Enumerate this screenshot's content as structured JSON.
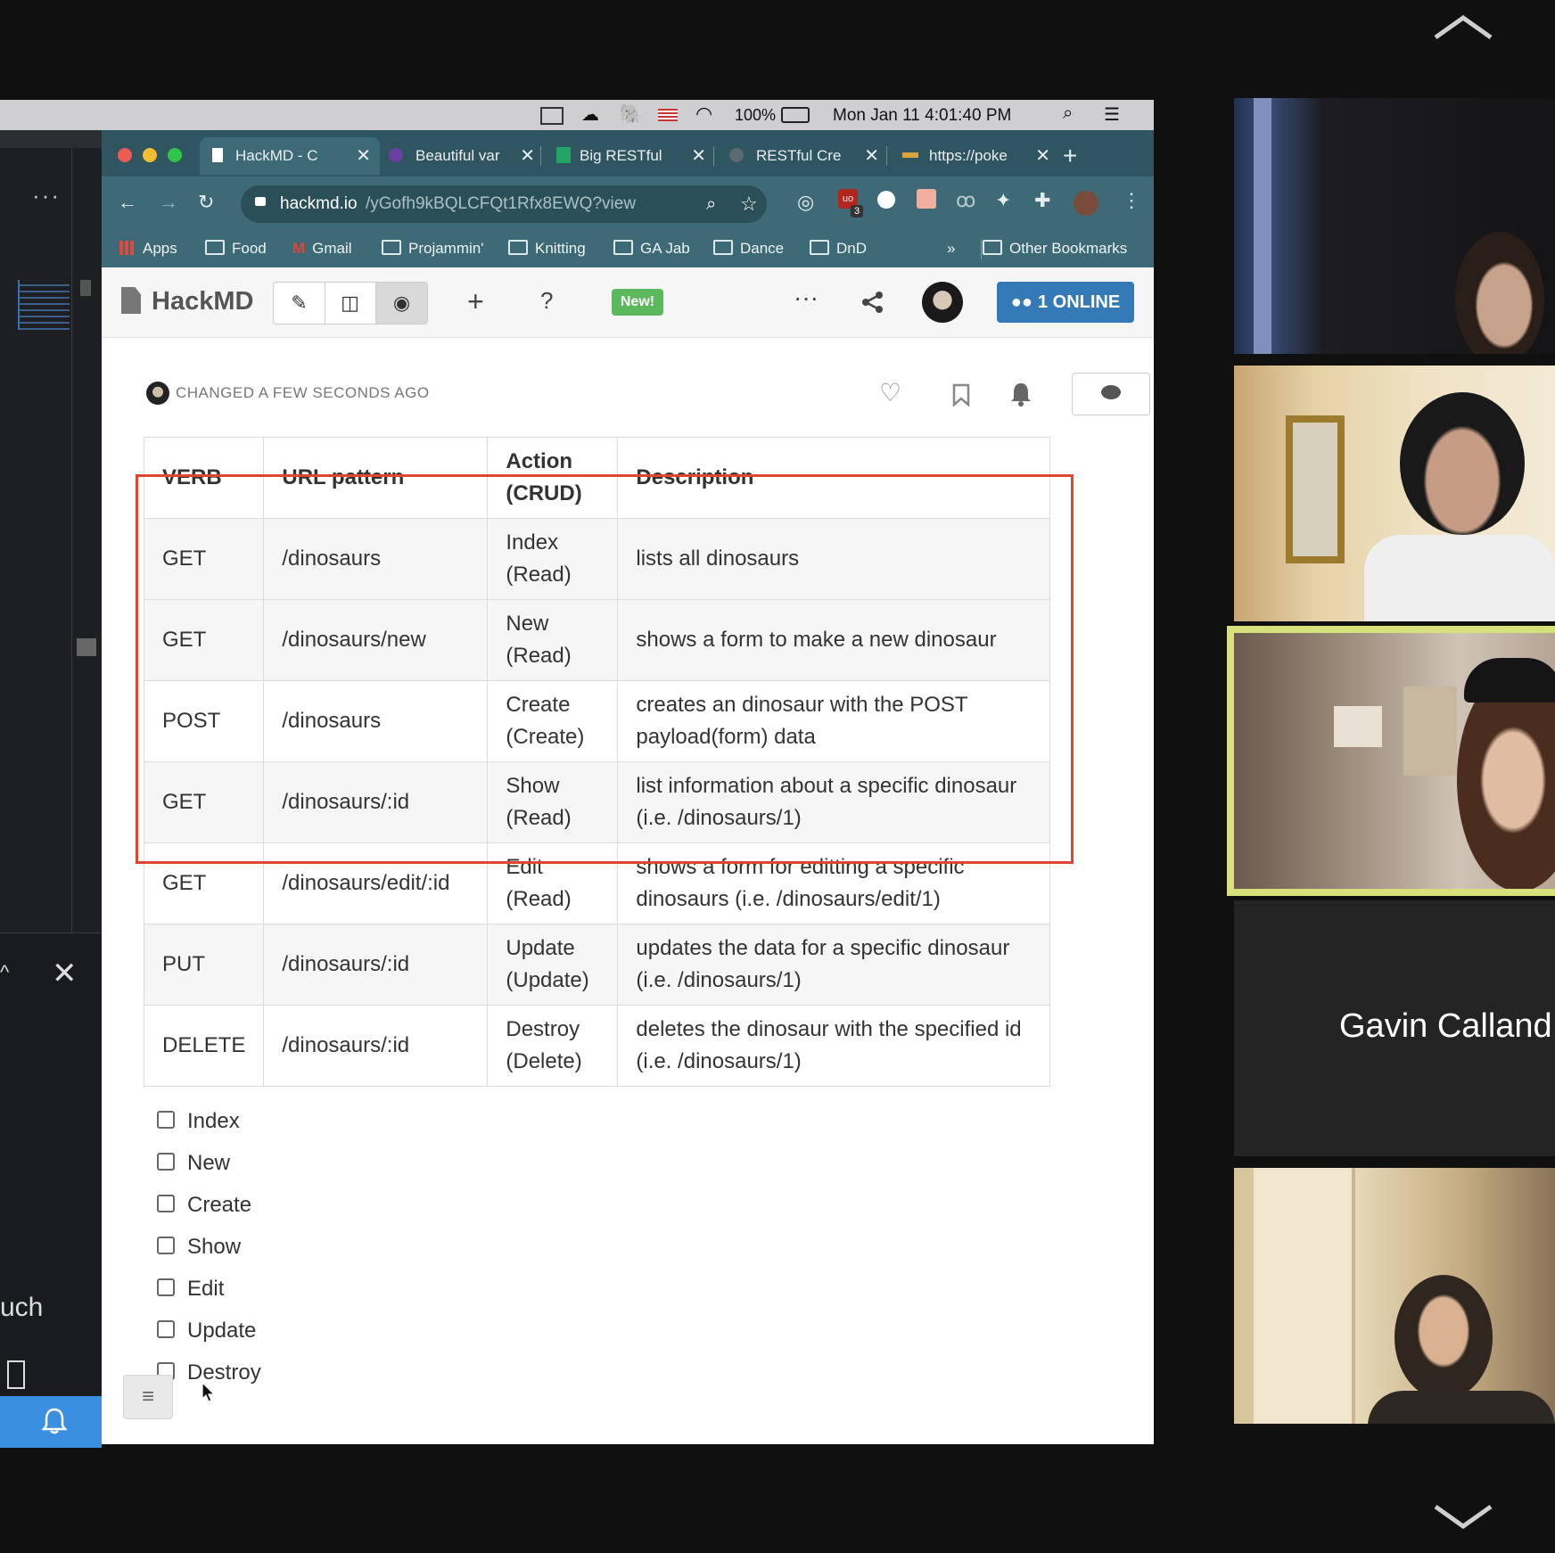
{
  "menubar": {
    "battery": "100%",
    "clock": "Mon Jan 11  4:01:40 PM"
  },
  "browser": {
    "tabs": [
      {
        "label": "HackMD - C"
      },
      {
        "label": "Beautiful var"
      },
      {
        "label": "Big RESTful"
      },
      {
        "label": "RESTful Cre"
      },
      {
        "label": "https://poke"
      }
    ],
    "url_host": "hackmd.io",
    "url_path": "/yGofh9kBQLCFQt1Rfx8EWQ?view",
    "bookmarks": [
      "Apps",
      "Food",
      "Gmail",
      "Projammin'",
      "Knitting",
      "GA Jab",
      "Dance",
      "DnD"
    ],
    "overflow": "»",
    "other_bookmarks": "Other Bookmarks",
    "extension_badge": "3"
  },
  "hackmd": {
    "logo": "HackMD",
    "new_badge": "New!",
    "online_count": "1 ONLINE",
    "changed_text": "CHANGED A FEW SECONDS AGO"
  },
  "table": {
    "headers": [
      "VERB",
      "URL pattern",
      "Action (CRUD)",
      "Description"
    ],
    "rows": [
      {
        "verb": "GET",
        "url": "/dinosaurs",
        "action": "Index (Read)",
        "desc": "lists all dinosaurs"
      },
      {
        "verb": "GET",
        "url": "/dinosaurs/new",
        "action": "New (Read)",
        "desc": "shows a form to make a new dinosaur"
      },
      {
        "verb": "POST",
        "url": "/dinosaurs",
        "action": "Create (Create)",
        "desc": "creates an dinosaur with the POST payload(form) data"
      },
      {
        "verb": "GET",
        "url": "/dinosaurs/:id",
        "action": "Show (Read)",
        "desc": "list information about a specific dinosaur (i.e. /dinosaurs/1)"
      },
      {
        "verb": "GET",
        "url": "/dinosaurs/edit/:id",
        "action": "Edit (Read)",
        "desc": "shows a form for editting a specific dinosaurs (i.e. /dinosaurs/edit/1)"
      },
      {
        "verb": "PUT",
        "url": "/dinosaurs/:id",
        "action": "Update (Update)",
        "desc": "updates the data for a specific dinosaur (i.e. /dinosaurs/1)"
      },
      {
        "verb": "DELETE",
        "url": "/dinosaurs/:id",
        "action": "Destroy (Delete)",
        "desc": "deletes the dinosaur with the specified id (i.e. /dinosaurs/1)"
      }
    ]
  },
  "tasks": [
    "Index",
    "New",
    "Create",
    "Show",
    "Edit",
    "Update",
    "Destroy"
  ],
  "left_pane": {
    "partial_text": "uch"
  },
  "participants": {
    "name_tile": "Gavin Calland"
  }
}
